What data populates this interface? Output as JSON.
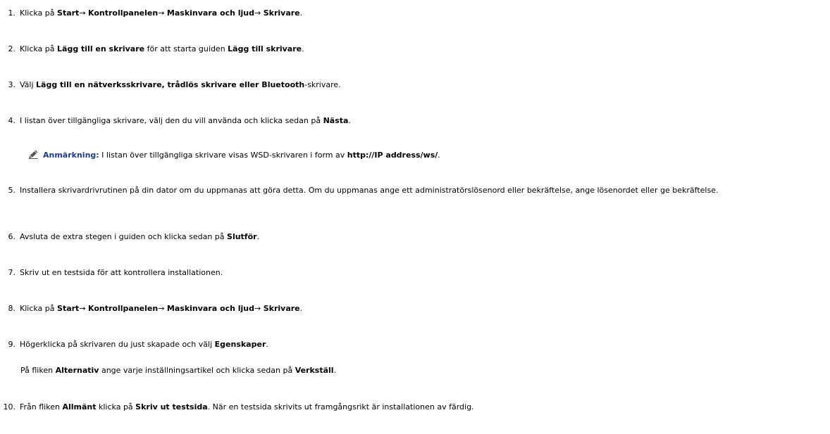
{
  "steps": {
    "s1": {
      "num": "1.",
      "pre": "Klicka på ",
      "a": "Start",
      "arrow1": "→ ",
      "b": "Kontrollpanelen",
      "arrow2": "→ ",
      "c": "Maskinvara och ljud",
      "arrow3": "→ ",
      "d": "Skrivare",
      "end": "."
    },
    "s2": {
      "num": "2.",
      "pre": "Klicka på ",
      "a": "Lägg till en skrivare",
      "mid": " för att starta guiden ",
      "b": "Lägg till skrivare",
      "end": "."
    },
    "s3": {
      "num": "3.",
      "pre": "Välj ",
      "a": "Lägg till en nätverksskrivare, trådlös skrivare eller Bluetooth",
      "end": "-skrivare."
    },
    "s4": {
      "num": "4.",
      "pre": "I listan över tillgängliga skrivare, välj den du vill använda och klicka sedan på ",
      "a": "Nästa",
      "end": "."
    },
    "note": {
      "label": "Anmärkning:",
      "text": " I listan över tillgängliga skrivare visas WSD-skrivaren i form av ",
      "code": "http://IP address/ws/",
      "end": ".",
      "icon": "pencil-note-icon"
    },
    "s5": {
      "num": "5.",
      "text": "Installera skrivardrivrutinen på din dator om du uppmanas att göra detta. Om du uppmanas ange ett administratörslösenord eller bekräftelse, ange lösenordet eller ge bekräftelse."
    },
    "s6": {
      "num": "6.",
      "pre": "Avsluta de extra stegen i guiden och klicka sedan på ",
      "a": "Slutför",
      "end": "."
    },
    "s7": {
      "num": "7.",
      "text": "Skriv ut en testsida för att kontrollera installationen."
    },
    "s8": {
      "num": "8.",
      "pre": "Klicka på ",
      "a": "Start",
      "arrow1": "→ ",
      "b": "Kontrollpanelen",
      "arrow2": "→ ",
      "c": "Maskinvara och ljud",
      "arrow3": "→ ",
      "d": "Skrivare",
      "end": "."
    },
    "s9": {
      "num": "9.",
      "pre": "Högerklicka på skrivaren du just skapade och välj ",
      "a": "Egenskaper",
      "end": "."
    },
    "s9sub": {
      "pre": "På fliken ",
      "a": "Alternativ",
      "mid": " ange varje inställningsartikel och klicka sedan på ",
      "b": "Verkställ",
      "end": "."
    },
    "s10": {
      "num": "10.",
      "pre": "Från fliken ",
      "a": "Allmänt",
      "mid": " klicka på ",
      "b": "Skriv ut testsida",
      "end": ". När en testsida skrivits ut framgångsrikt är installationen av färdig."
    }
  }
}
